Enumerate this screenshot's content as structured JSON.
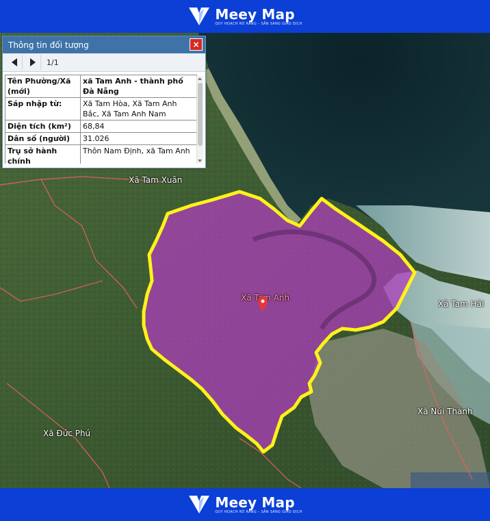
{
  "brand": {
    "name": "Meey Map",
    "tagline": "QUY HOẠCH RÕ RÀNG – SẴN SÀNG GIAO DỊCH"
  },
  "panel": {
    "title": "Thông tin đối tượng",
    "close_label": "×",
    "page_indicator": "1/1",
    "rows": [
      {
        "key": "Tên Phường/Xã (mới)",
        "value": "xã Tam Anh - thành phố Đà Nẵng"
      },
      {
        "key": "Sáp nhập từ:",
        "value": "Xã Tam Hòa, Xã Tam Anh Bắc, Xã Tam Anh Nam"
      },
      {
        "key": "Diện tích (km²)",
        "value": "68,84"
      },
      {
        "key": "Dân số (người)",
        "value": "31.026"
      },
      {
        "key": "Trụ sở hành chính",
        "value": "Thôn Nam Định, xã Tam Anh"
      }
    ]
  },
  "map": {
    "labels": {
      "tam_xuan": "Xã Tam Xuân",
      "tam_anh": "Xã Tam Anh",
      "tam_hai": "Xã Tam Hải",
      "nui_thanh": "Xã Núi Thành",
      "duc_phu": "Xã Đức Phú"
    },
    "colors": {
      "boundary": "#fff21a",
      "area_fill": "#b23dbf",
      "sea": "#0f2a33",
      "land": "#3d5a32"
    }
  }
}
